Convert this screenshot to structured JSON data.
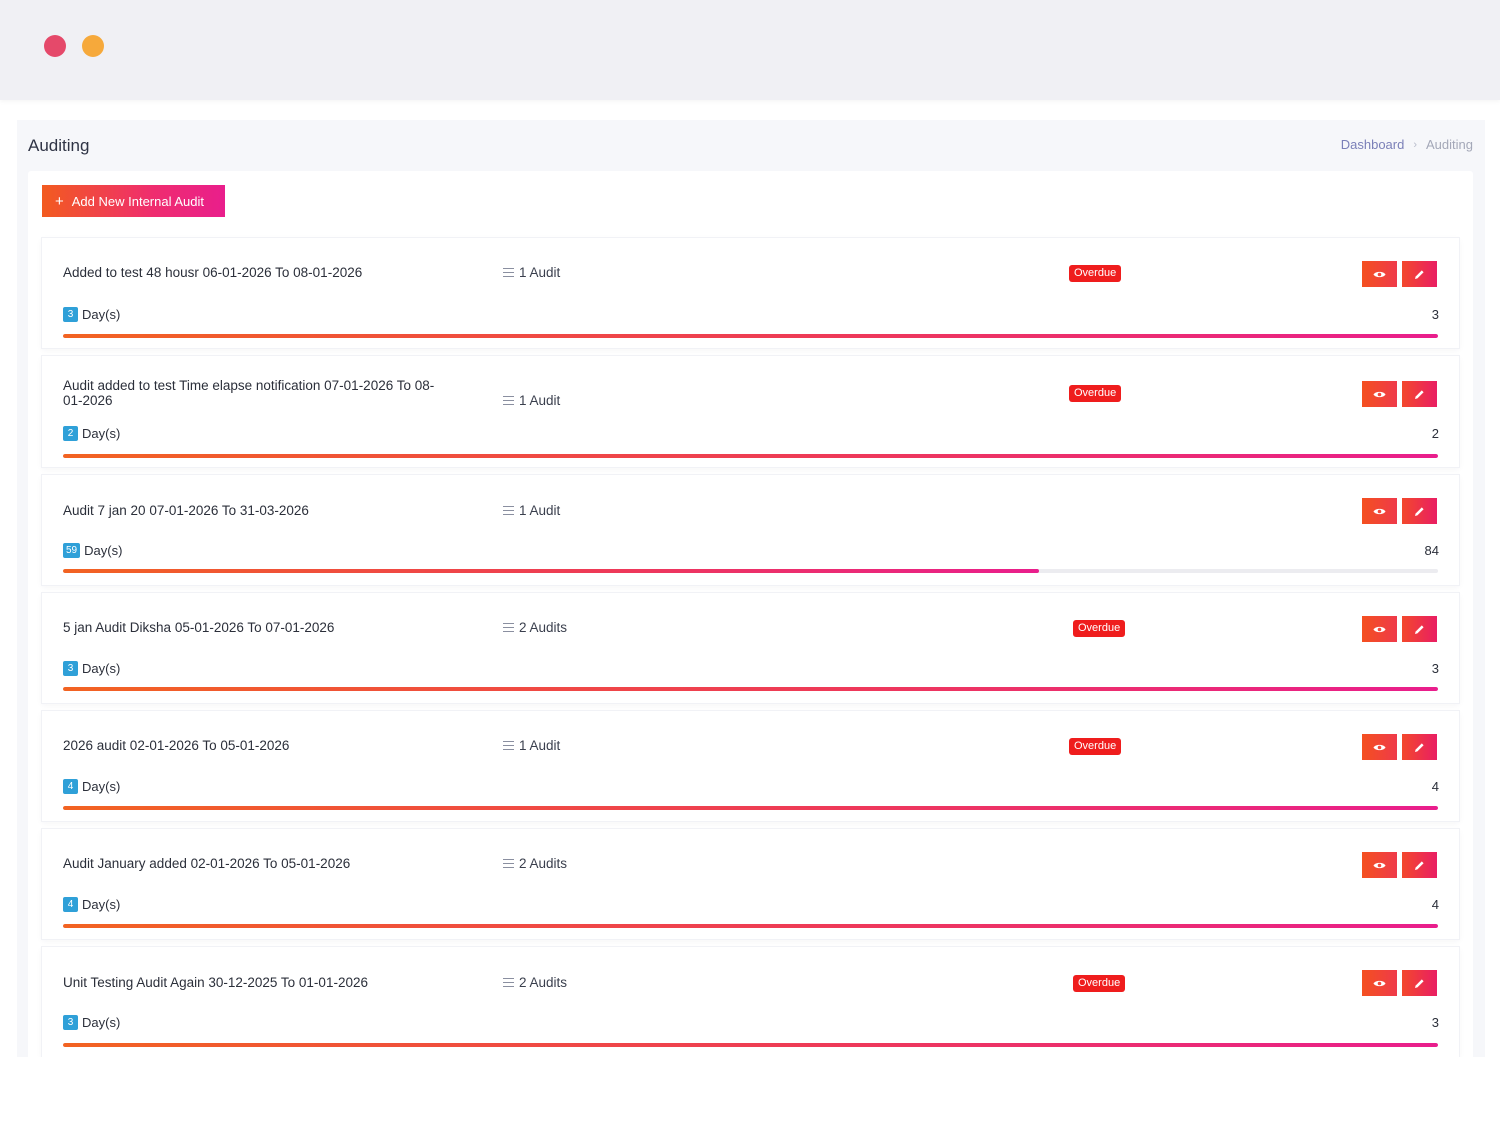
{
  "window": {
    "controls": [
      "close",
      "minimize"
    ]
  },
  "header": {
    "title": "Auditing"
  },
  "breadcrumb": {
    "items": [
      "Dashboard",
      "Auditing"
    ],
    "separator": "›"
  },
  "toolbar": {
    "add_label": "Add New Internal Audit",
    "add_icon": "+"
  },
  "colors": {
    "accent_start": "#f26322",
    "accent_end": "#e91e8c",
    "overdue": "#ef1d1d",
    "day_badge": "#2fa0d8"
  },
  "days_label": "Day(s)",
  "audits": [
    {
      "title": "Added to test 48 housr 06-01-2026 To 08-01-2026",
      "count": "1 Audit",
      "status": "Overdue",
      "days": "3",
      "total": "3",
      "progress": 1.0
    },
    {
      "title": "Audit added to test Time elapse notification 07-01-2026 To 08-01-2026",
      "count": "1 Audit",
      "status": "Overdue",
      "days": "2",
      "total": "2",
      "progress": 1.0
    },
    {
      "title": "Audit 7 jan 20 07-01-2026 To 31-03-2026",
      "count": "1 Audit",
      "status": "",
      "days": "59",
      "total": "84",
      "progress": 0.71
    },
    {
      "title": "5 jan Audit Diksha 05-01-2026 To 07-01-2026",
      "count": "2 Audits",
      "status": "Overdue",
      "days": "3",
      "total": "3",
      "progress": 1.0
    },
    {
      "title": "2026 audit 02-01-2026 To 05-01-2026",
      "count": "1 Audit",
      "status": "Overdue",
      "days": "4",
      "total": "4",
      "progress": 1.0
    },
    {
      "title": "Audit January added 02-01-2026 To 05-01-2026",
      "count": "2 Audits",
      "status": "",
      "days": "4",
      "total": "4",
      "progress": 1.0
    },
    {
      "title": "Unit Testing Audit Again 30-12-2025 To 01-01-2026",
      "count": "2 Audits",
      "status": "Overdue",
      "days": "3",
      "total": "3",
      "progress": 1.0
    }
  ],
  "icons": {
    "view": "eye-icon",
    "edit": "pencil-icon",
    "count": "list-icon"
  }
}
